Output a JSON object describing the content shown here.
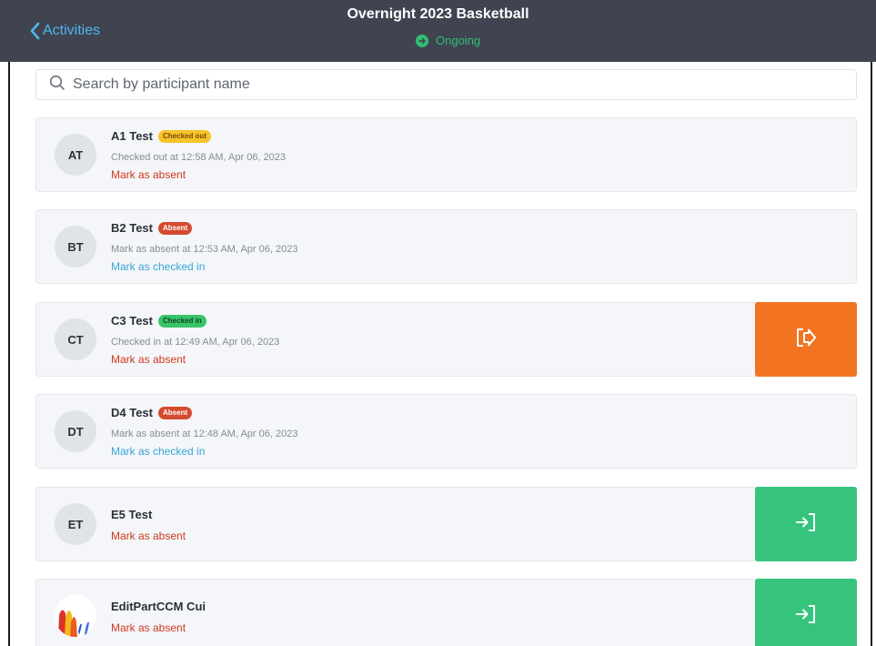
{
  "header": {
    "back_label": "Activities",
    "title": "Overnight 2023 Basketball",
    "status": "Ongoing"
  },
  "search": {
    "placeholder": "Search by participant name",
    "value": ""
  },
  "colors": {
    "header_bg": "#3f4450",
    "accent_blue": "#4fb8ea",
    "status_green": "#2fbf71",
    "checkout_orange": "#f27420",
    "checkin_green": "#36c47d"
  },
  "participants": [
    {
      "initials": "AT",
      "name": "A1 Test",
      "badge": "Checked out",
      "meta": "Checked out at 12:58 AM, Apr 06, 2023",
      "action": "Mark as absent"
    },
    {
      "initials": "BT",
      "name": "B2 Test",
      "badge": "Absent",
      "meta": "Mark as absent at 12:53 AM, Apr 06, 2023",
      "action": "Mark as checked in"
    },
    {
      "initials": "CT",
      "name": "C3 Test",
      "badge": "Checked in",
      "meta": "Checked in at 12:49 AM, Apr 06, 2023",
      "action": "Mark as absent",
      "side_button_icon": "check-out-icon"
    },
    {
      "initials": "DT",
      "name": "D4 Test",
      "badge": "Absent",
      "meta": "Mark as absent at 12:48 AM, Apr 06, 2023",
      "action": "Mark as checked in"
    },
    {
      "initials": "ET",
      "name": "E5 Test",
      "action": "Mark as absent",
      "side_button_icon": "check-in-icon"
    },
    {
      "initials": "",
      "name": "EditPartCCM Cui",
      "action": "Mark as absent",
      "side_button_icon": "check-in-icon"
    }
  ]
}
